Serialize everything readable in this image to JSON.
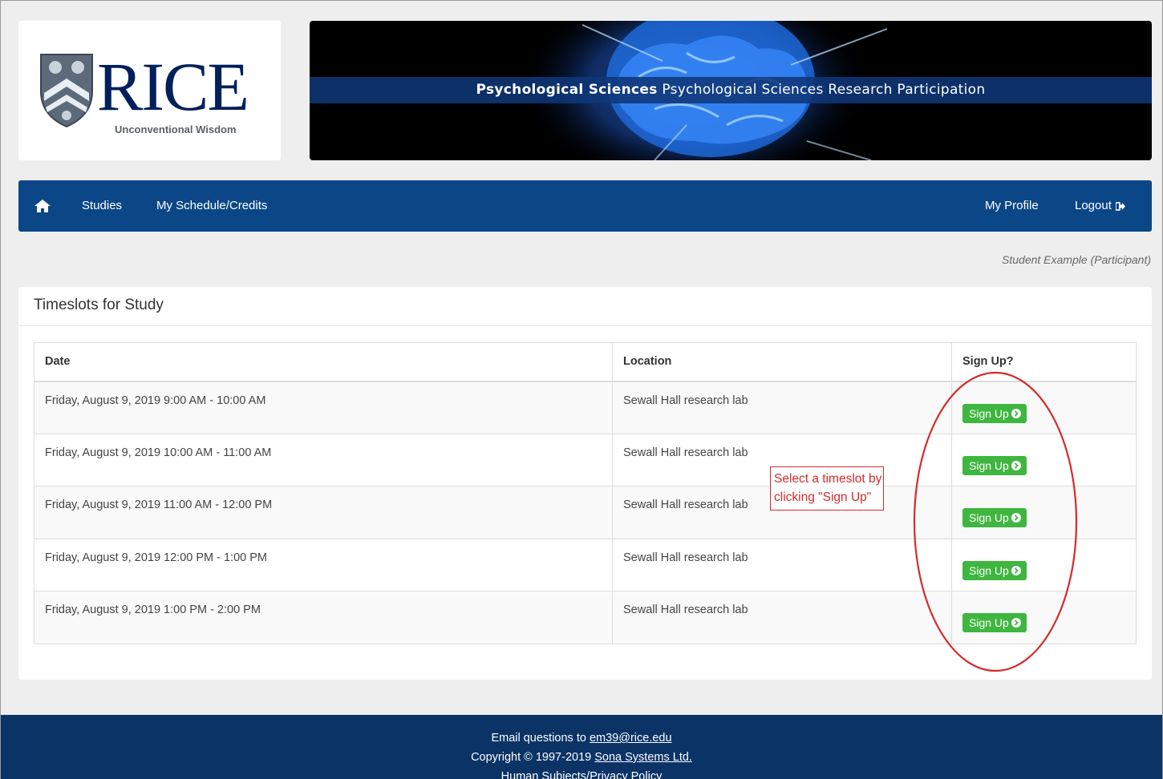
{
  "header": {
    "logo_word": "RICE",
    "logo_tagline": "Unconventional Wisdom",
    "banner_bold": "Psychological Sciences",
    "banner_rest": " Psychological Sciences Research Participation"
  },
  "nav": {
    "home_icon": "home-icon",
    "items": [
      {
        "label": "Studies"
      },
      {
        "label": "My Schedule/Credits"
      }
    ],
    "right": {
      "profile": "My Profile",
      "logout": "Logout",
      "logout_icon": "sign-out-icon"
    }
  },
  "user_line": "Student Example (Participant)",
  "panel": {
    "title": "Timeslots for Study",
    "columns": [
      "Date",
      "Location",
      "Sign Up?"
    ],
    "rows": [
      {
        "date": "Friday, August 9, 2019 9:00 AM - 10:00 AM",
        "location": "Sewall Hall research lab",
        "button": "Sign Up"
      },
      {
        "date": "Friday, August 9, 2019 10:00 AM - 11:00 AM",
        "location": "Sewall Hall research lab",
        "button": "Sign Up"
      },
      {
        "date": "Friday, August 9, 2019 11:00 AM - 12:00 PM",
        "location": "Sewall Hall research lab",
        "button": "Sign Up"
      },
      {
        "date": "Friday, August 9, 2019 12:00 PM - 1:00 PM",
        "location": "Sewall Hall research lab",
        "button": "Sign Up"
      },
      {
        "date": "Friday, August 9, 2019 1:00 PM - 2:00 PM",
        "location": "Sewall Hall research lab",
        "button": "Sign Up"
      }
    ]
  },
  "annotation": {
    "line1": "Select a timeslot by",
    "line2": "clicking \"Sign Up\"",
    "color": "#d62b2b"
  },
  "footer": {
    "email_prefix": "Email questions to ",
    "email": "em39@rice.edu",
    "copyright_prefix": "Copyright © 1997-2019 ",
    "company": "Sona Systems Ltd.",
    "privacy": "Human Subjects/Privacy Policy"
  },
  "colors": {
    "navbar": "#0b4787",
    "footer": "#0b3366",
    "button": "#3fb63f",
    "rice_blue": "#00205b"
  }
}
